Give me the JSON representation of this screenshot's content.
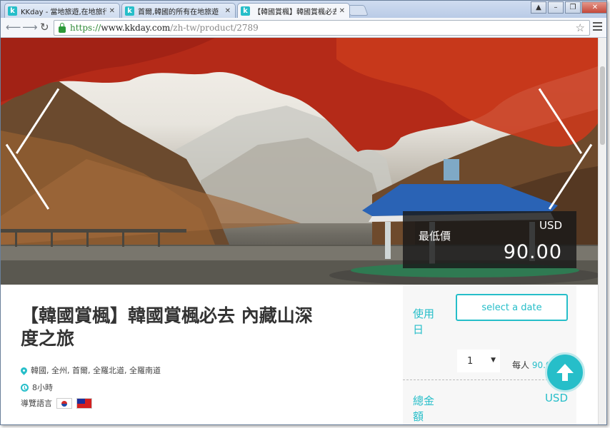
{
  "browser": {
    "tabs": [
      {
        "favicon": "k",
        "title": "KKday - 當地旅遊,在地旅行"
      },
      {
        "favicon": "k",
        "title": "首爾,韓國的所有在地旅遊"
      },
      {
        "favicon": "k",
        "title": "【韓國賞楓】韓國賞楓必去"
      }
    ],
    "url": {
      "protocol": "https://",
      "host": "www.kkday.com",
      "path": "/zh-tw/product/2789"
    }
  },
  "hero": {
    "price_label": "最低價",
    "currency": "USD",
    "price": "90.00"
  },
  "product": {
    "title": "【韓國賞楓】韓國賞楓必去 內藏山深度之旅",
    "location": "韓國, 全州, 首爾, 全羅北道, 全羅南道",
    "duration": "8小時",
    "guide_language_label": "導覽語言"
  },
  "booking": {
    "use_day_label": "使用日",
    "select_date": "select a date",
    "quantity": "1",
    "per_person_label": "每人",
    "per_person_value": "90.00",
    "total_label": "總金額",
    "total_currency": "USD"
  },
  "colors": {
    "accent": "#26bec9",
    "price_box": "#191919"
  },
  "icons": [
    "back-icon",
    "forward-icon",
    "reload-icon",
    "lock-icon",
    "star-icon",
    "menu-icon",
    "location-pin-icon",
    "clock-icon",
    "korea-flag-icon",
    "taiwan-flag-icon",
    "scroll-top-icon"
  ]
}
